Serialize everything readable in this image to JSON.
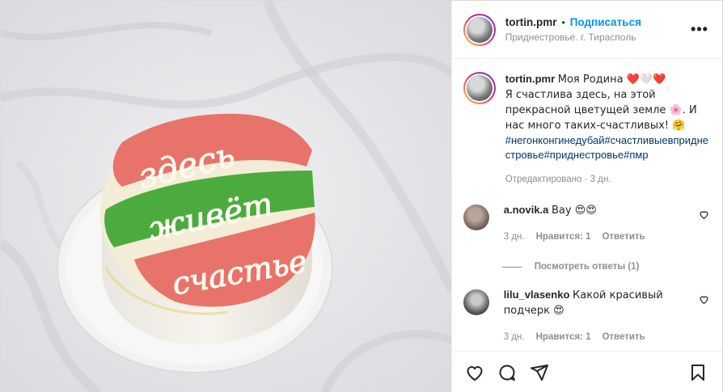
{
  "header": {
    "username": "tortin.pmr",
    "separator": "•",
    "follow_label": "Подписаться",
    "location": "Приднестровье. г. Тирасполь",
    "more_label": "•••"
  },
  "cake": {
    "line1": "здесь",
    "line2": "живёт",
    "line3": "счастье",
    "colors": {
      "red": "#e8736a",
      "green": "#4cab3f",
      "cream": "#f5ecd8"
    }
  },
  "caption": {
    "username": "tortin.pmr",
    "text_line1": "Моя Родина ❤️🤍❤️",
    "text_body": "Я счастлива здесь, на этой прекрасной цветущей земле 🌸. И нас много таких-счастливых! 🤗",
    "hashtags": "#негонконгинедубай#счастливыевприднестровье#приднестровье#пмр",
    "edited": "Отредактировано · 3 дн."
  },
  "comments": [
    {
      "username": "a.novik.a",
      "text": "Вау 😍😍",
      "time": "3 дн.",
      "likes": "Нравится: 1",
      "reply": "Ответить"
    },
    {
      "username": "lilu_vlasenko",
      "text": "Какой красивый подчерк 😍",
      "time": "3 дн.",
      "likes": "Нравится: 1",
      "reply": "Ответить"
    }
  ],
  "view_replies": "Посмотреть ответы (1)",
  "icons": [
    "heart-icon",
    "comment-icon",
    "share-icon",
    "bookmark-icon",
    "more-icon"
  ]
}
